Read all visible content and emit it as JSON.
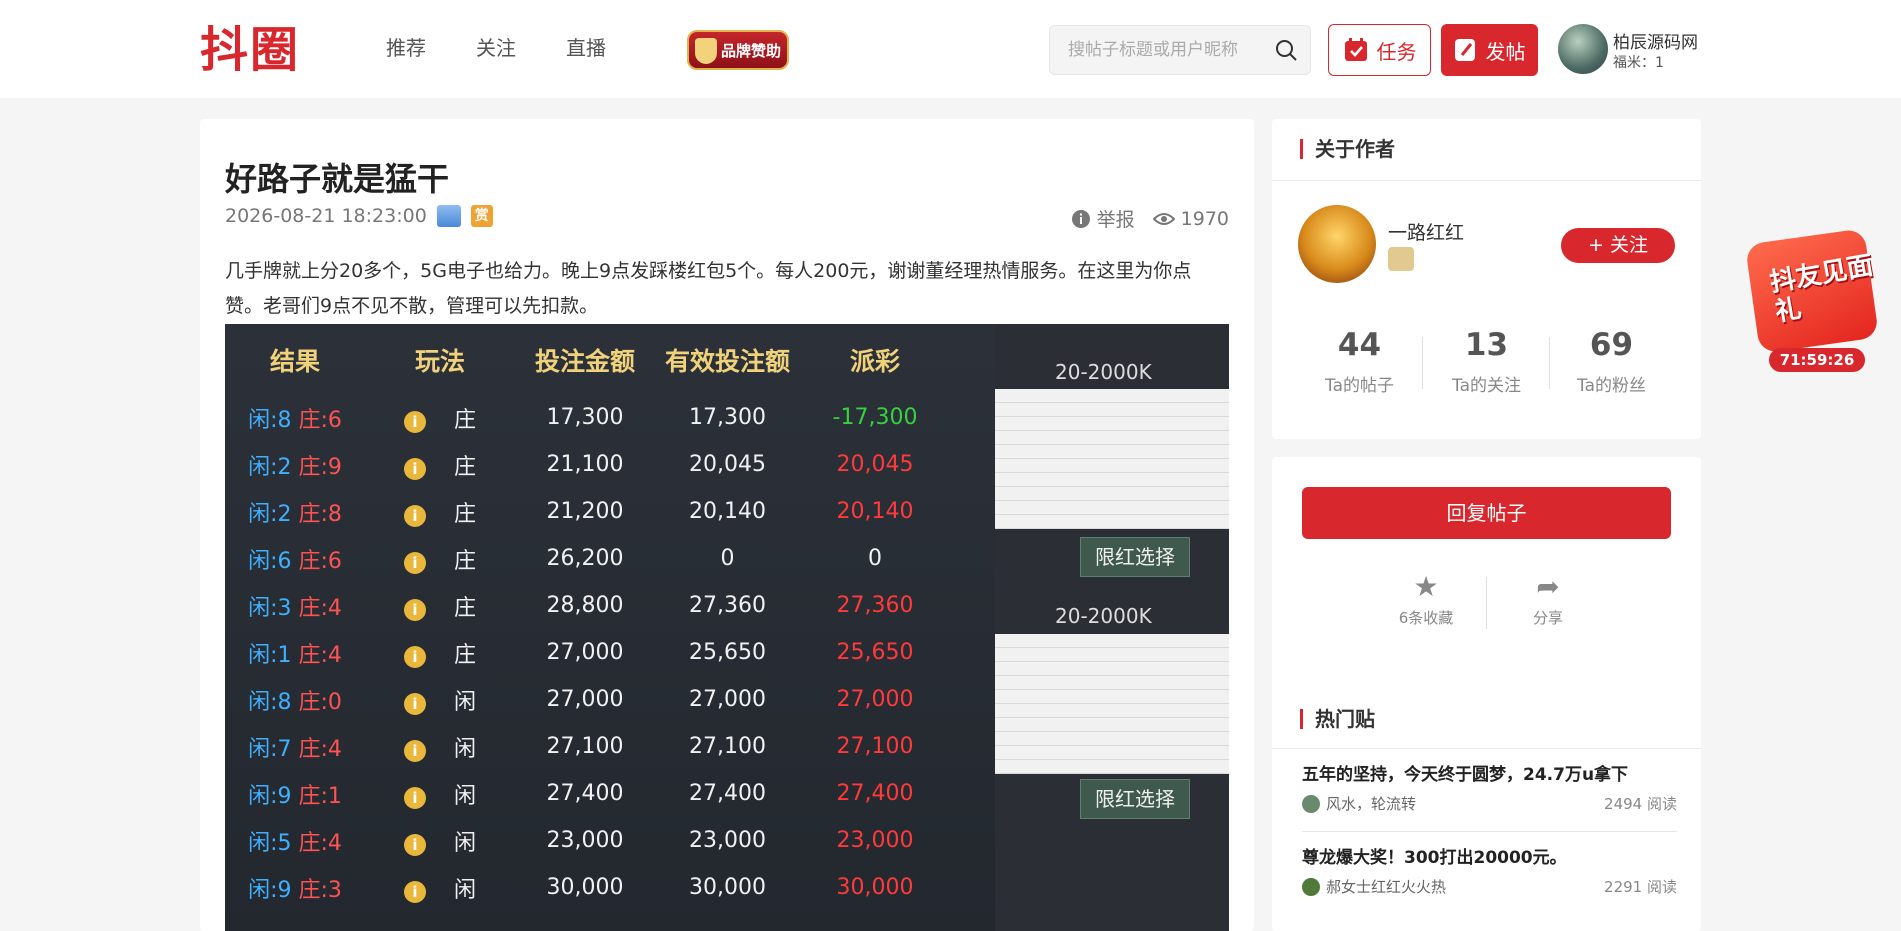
{
  "header": {
    "logo": "抖圈",
    "nav": [
      "推荐",
      "关注",
      "直播"
    ],
    "brand_badge": "品牌赞助",
    "search_placeholder": "搜帖子标题或用户昵称",
    "task_label": "任务",
    "post_label": "发帖",
    "user_name": "柏辰源码网",
    "user_coins": "福米：1"
  },
  "post": {
    "title": "好路子就是猛干",
    "datetime": "2026-08-21 18:23:00",
    "reward_icon": "赏",
    "report_label": "举报",
    "views": "1970",
    "body": "几手牌就上分20多个，5G电子也给力。晚上9点发踩楼红包5个。每人200元，谢谢董经理热情服务。在这里为你点赞。老哥们9点不见不散，管理可以先扣款。",
    "image": {
      "headers": [
        "结果",
        "玩法",
        "投注金额",
        "有效投注额",
        "派彩"
      ],
      "rows": [
        {
          "xian": "闲:8",
          "zhuang": "庄:6",
          "play": "庄",
          "bet": "17,300",
          "valid": "17,300",
          "payout": "-17,300",
          "kind": "lose"
        },
        {
          "xian": "闲:2",
          "zhuang": "庄:9",
          "play": "庄",
          "bet": "21,100",
          "valid": "20,045",
          "payout": "20,045",
          "kind": "win"
        },
        {
          "xian": "闲:2",
          "zhuang": "庄:8",
          "play": "庄",
          "bet": "21,200",
          "valid": "20,140",
          "payout": "20,140",
          "kind": "win"
        },
        {
          "xian": "闲:6",
          "zhuang": "庄:6",
          "play": "庄",
          "bet": "26,200",
          "valid": "0",
          "payout": "0",
          "kind": "tie"
        },
        {
          "xian": "闲:3",
          "zhuang": "庄:4",
          "play": "庄",
          "bet": "28,800",
          "valid": "27,360",
          "payout": "27,360",
          "kind": "win"
        },
        {
          "xian": "闲:1",
          "zhuang": "庄:4",
          "play": "庄",
          "bet": "27,000",
          "valid": "25,650",
          "payout": "25,650",
          "kind": "win"
        },
        {
          "xian": "闲:8",
          "zhuang": "庄:0",
          "play": "闲",
          "bet": "27,000",
          "valid": "27,000",
          "payout": "27,000",
          "kind": "win"
        },
        {
          "xian": "闲:7",
          "zhuang": "庄:4",
          "play": "闲",
          "bet": "27,100",
          "valid": "27,100",
          "payout": "27,100",
          "kind": "win"
        },
        {
          "xian": "闲:9",
          "zhuang": "庄:1",
          "play": "闲",
          "bet": "27,400",
          "valid": "27,400",
          "payout": "27,400",
          "kind": "win"
        },
        {
          "xian": "闲:5",
          "zhuang": "庄:4",
          "play": "闲",
          "bet": "23,000",
          "valid": "23,000",
          "payout": "23,000",
          "kind": "win"
        },
        {
          "xian": "闲:9",
          "zhuang": "庄:3",
          "play": "闲",
          "bet": "30,000",
          "valid": "30,000",
          "payout": "30,000",
          "kind": "win"
        }
      ],
      "limit_label_1": "20-2000K",
      "limit_btn_1": "限红选择",
      "limit_label_2": "20-2000K",
      "limit_btn_2": "限红选择"
    }
  },
  "author": {
    "section_title": "关于作者",
    "name": "一路红红",
    "follow_label": "+ 关注",
    "stats": [
      {
        "num": "44",
        "label": "Ta的帖子"
      },
      {
        "num": "13",
        "label": "Ta的关注"
      },
      {
        "num": "69",
        "label": "Ta的粉丝"
      }
    ]
  },
  "actions": {
    "reply_label": "回复帖子",
    "favorite_label": "6条收藏",
    "share_label": "分享"
  },
  "hot": {
    "section_title": "热门贴",
    "items": [
      {
        "title": "五年的坚持，今天终于圆梦，24.7万u拿下",
        "author": "风水，轮流转",
        "reads": "2494 阅读"
      },
      {
        "title": "尊龙爆大奖！300打出20000元。",
        "author": "郝女士红红火火热",
        "reads": "2291 阅读"
      }
    ]
  },
  "float": {
    "gift_text": "抖友见面礼",
    "timer": "71:59:26"
  }
}
